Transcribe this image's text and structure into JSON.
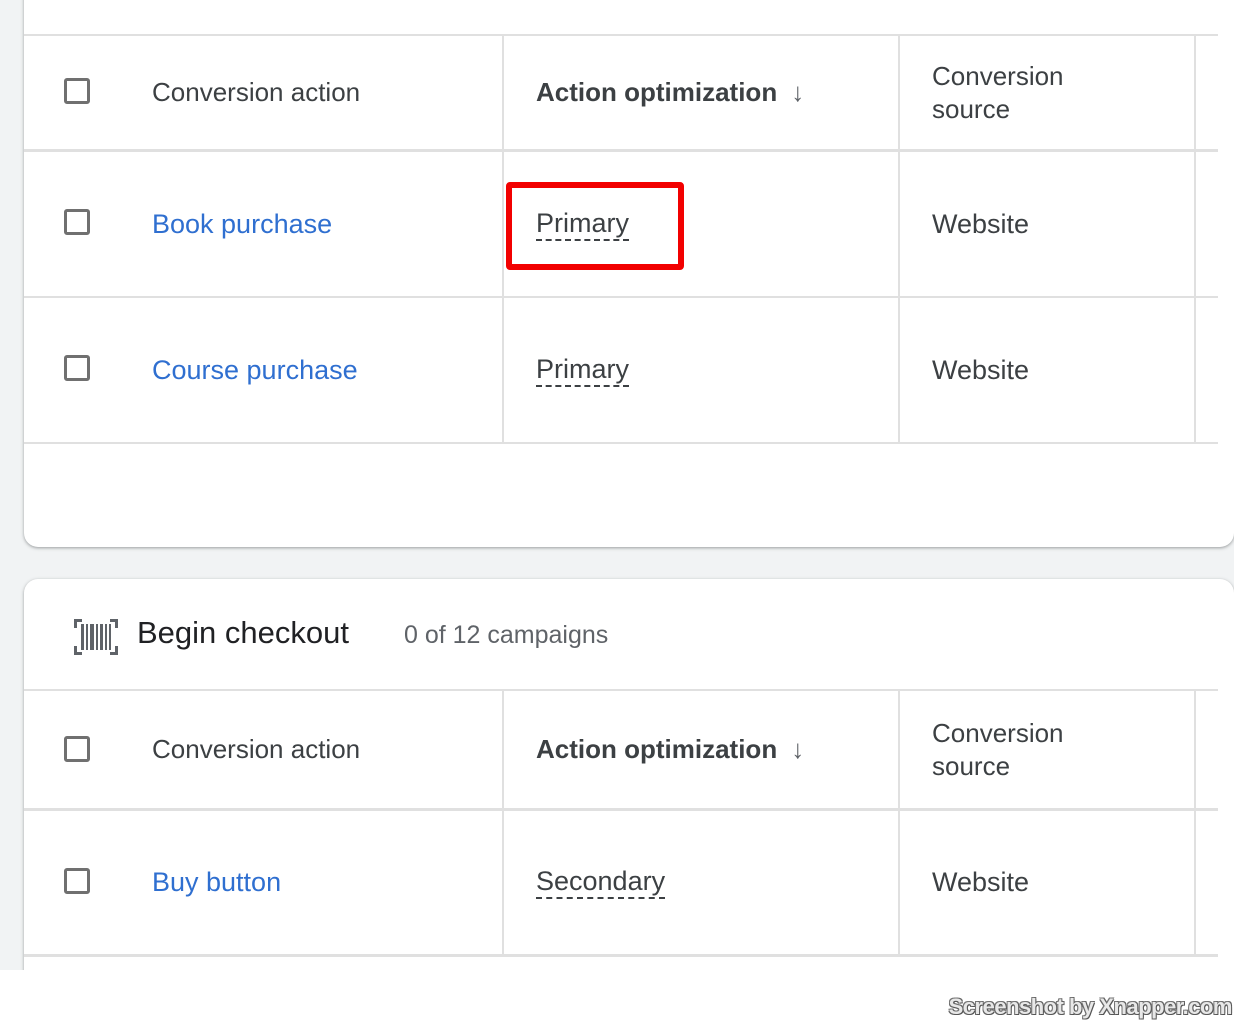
{
  "tables": [
    {
      "columns": {
        "conversion_action": "Conversion action",
        "action_optimization": "Action optimization",
        "conversion_source_line1": "Conversion",
        "conversion_source_line2": "source"
      },
      "sort_icon": "arrow-down-icon",
      "rows": [
        {
          "conversion_action": "Book purchase",
          "action_optimization": "Primary",
          "conversion_source": "Website",
          "highlighted": true
        },
        {
          "conversion_action": "Course purchase",
          "action_optimization": "Primary",
          "conversion_source": "Website",
          "highlighted": false
        }
      ]
    },
    {
      "section": {
        "icon": "barcode-icon",
        "title": "Begin checkout",
        "subtitle": "0 of 12 campaigns"
      },
      "columns": {
        "conversion_action": "Conversion action",
        "action_optimization": "Action optimization",
        "conversion_source_line1": "Conversion",
        "conversion_source_line2": "source"
      },
      "sort_icon": "arrow-down-icon",
      "rows": [
        {
          "conversion_action": "Buy button",
          "action_optimization": "Secondary",
          "conversion_source": "Website"
        }
      ]
    }
  ],
  "colors": {
    "link": "#2f6fd0",
    "highlight": "#f20000",
    "background": "#f1f3f4"
  },
  "watermark": "Screenshot by Xnapper.com"
}
